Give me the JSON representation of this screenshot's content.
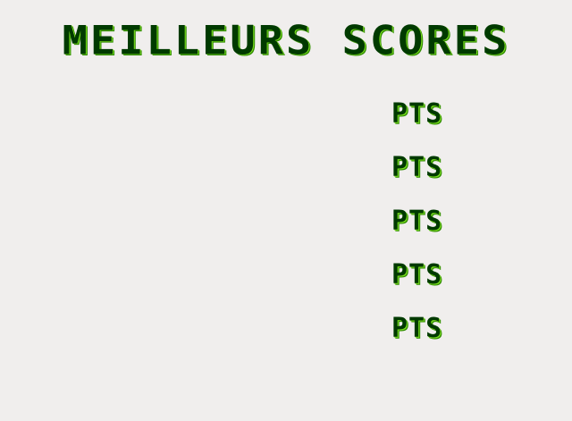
{
  "title": "MEILLEURS SCORES",
  "scores": [
    {
      "name": "",
      "value": "",
      "unit": "PTS"
    },
    {
      "name": "",
      "value": "",
      "unit": "PTS"
    },
    {
      "name": "",
      "value": "",
      "unit": "PTS"
    },
    {
      "name": "",
      "value": "",
      "unit": "PTS"
    },
    {
      "name": "",
      "value": "",
      "unit": "PTS"
    }
  ],
  "colors": {
    "background": "#f0eeed",
    "text": "#003a00",
    "text_highlight": "#7de021"
  }
}
